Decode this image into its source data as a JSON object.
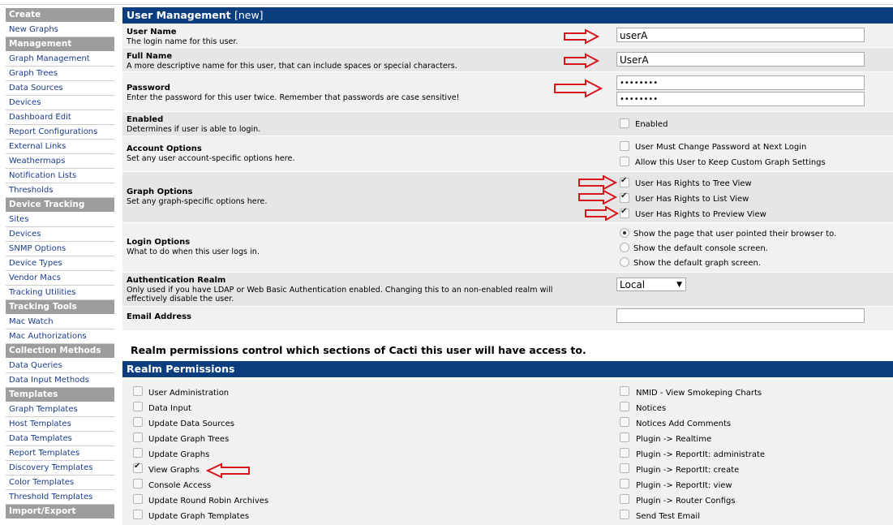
{
  "sidebar": {
    "sections": [
      {
        "title": "Create",
        "items": [
          "New Graphs"
        ]
      },
      {
        "title": "Management",
        "items": [
          "Graph Management",
          "Graph Trees",
          "Data Sources",
          "Devices",
          "Dashboard Edit",
          "Report Configurations",
          "External Links",
          "Weathermaps",
          "Notification Lists",
          "Thresholds"
        ]
      },
      {
        "title": "Device Tracking",
        "items": [
          "Sites",
          "Devices",
          "SNMP Options",
          "Device Types",
          "Vendor Macs",
          "Tracking Utilities"
        ]
      },
      {
        "title": "Tracking Tools",
        "items": [
          "Mac Watch",
          "Mac Authorizations"
        ]
      },
      {
        "title": "Collection Methods",
        "items": [
          "Data Queries",
          "Data Input Methods"
        ]
      },
      {
        "title": "Templates",
        "items": [
          "Graph Templates",
          "Host Templates",
          "Data Templates",
          "Report Templates",
          "Discovery Templates",
          "Color Templates",
          "Threshold Templates"
        ]
      },
      {
        "title": "Import/Export",
        "items": []
      }
    ]
  },
  "form": {
    "header": "User Management",
    "header_suffix": "[new]",
    "username": {
      "title": "User Name",
      "desc": "The login name for this user.",
      "value": "userA"
    },
    "fullname": {
      "title": "Full Name",
      "desc": "A more descriptive name for this user, that can include spaces or special characters.",
      "value": "UserA"
    },
    "password": {
      "title": "Password",
      "desc": "Enter the password for this user twice. Remember that passwords are case sensitive!",
      "value1": "••••••••",
      "value2": "••••••••"
    },
    "enabled": {
      "title": "Enabled",
      "desc": "Determines if user is able to login.",
      "option": "Enabled"
    },
    "account": {
      "title": "Account Options",
      "desc": "Set any user account-specific options here.",
      "opt1": "User Must Change Password at Next Login",
      "opt2": "Allow this User to Keep Custom Graph Settings"
    },
    "graph": {
      "title": "Graph Options",
      "desc": "Set any graph-specific options here.",
      "opt1": "User Has Rights to Tree View",
      "opt2": "User Has Rights to List View",
      "opt3": "User Has Rights to Preview View"
    },
    "login": {
      "title": "Login Options",
      "desc": "What to do when this user logs in.",
      "opt1": "Show the page that user pointed their browser to.",
      "opt2": "Show the default console screen.",
      "opt3": "Show the default graph screen."
    },
    "realm": {
      "title": "Authentication Realm",
      "desc1": "Only used if you have LDAP or Web Basic Authentication enabled. Changing this to an non-enabled realm will",
      "desc2": "effectively disable the user.",
      "value": "Local",
      "caret": "▼"
    },
    "email": {
      "title": "Email Address",
      "value": ""
    }
  },
  "realm_note": "Realm permissions control which sections of Cacti this user will have access to.",
  "permissions": {
    "header": "Realm Permissions",
    "left": [
      {
        "label": "User Administration",
        "checked": false
      },
      {
        "label": "Data Input",
        "checked": false
      },
      {
        "label": "Update Data Sources",
        "checked": false
      },
      {
        "label": "Update Graph Trees",
        "checked": false
      },
      {
        "label": "Update Graphs",
        "checked": false
      },
      {
        "label": "View Graphs",
        "checked": true
      },
      {
        "label": "Console Access",
        "checked": false
      },
      {
        "label": "Update Round Robin Archives",
        "checked": false
      },
      {
        "label": "Update Graph Templates",
        "checked": false
      }
    ],
    "right": [
      {
        "label": "NMID - View Smokeping Charts",
        "checked": false
      },
      {
        "label": "Notices",
        "checked": false
      },
      {
        "label": "Notices Add Comments",
        "checked": false
      },
      {
        "label": "Plugin -> Realtime",
        "checked": false
      },
      {
        "label": "Plugin -> ReportIt: administrate",
        "checked": false
      },
      {
        "label": "Plugin -> ReportIt: create",
        "checked": false
      },
      {
        "label": "Plugin -> ReportIt: view",
        "checked": false
      },
      {
        "label": "Plugin -> Router Configs",
        "checked": false
      },
      {
        "label": "Send Test Email",
        "checked": false
      }
    ]
  },
  "colors": {
    "header_bg": "#0c3e7f",
    "sidebar_head_bg": "#9d9d9d",
    "link": "#1a3b8c",
    "arrow": "#d9151c"
  }
}
